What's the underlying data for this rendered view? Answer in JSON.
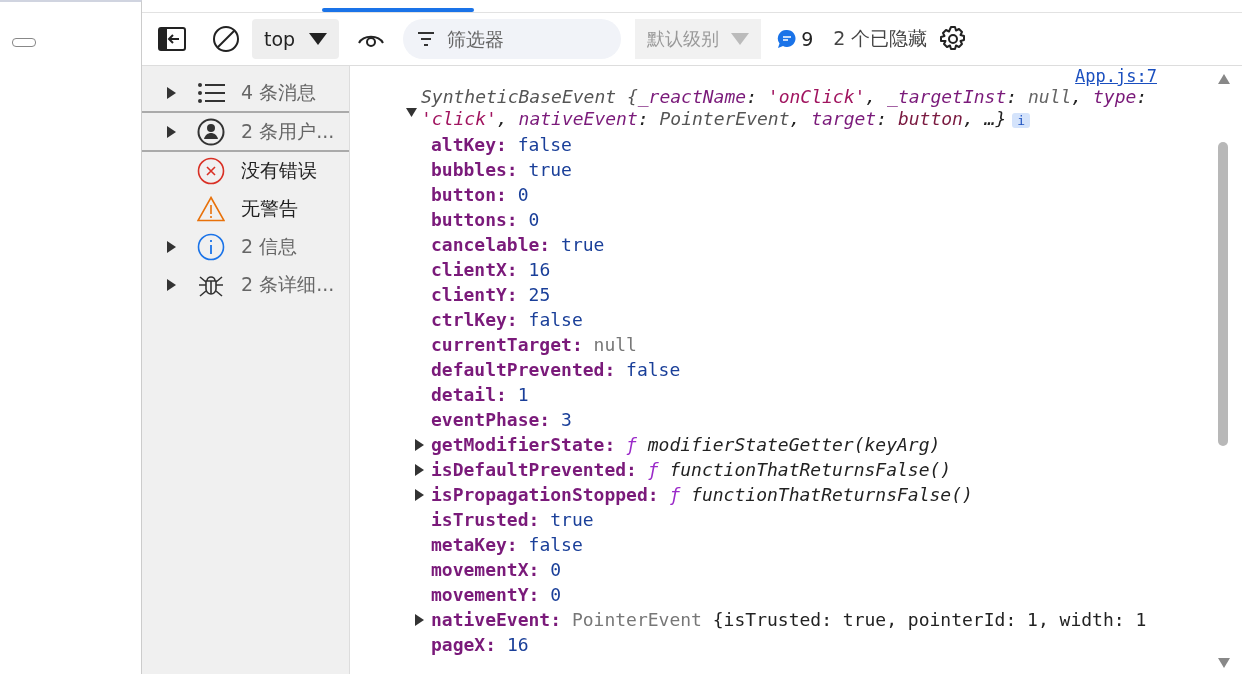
{
  "toolbar": {
    "context": "top",
    "filter": {
      "placeholder": "筛选器"
    },
    "level_menu": {
      "label": "默认级别",
      "disabled": true
    },
    "message_count": "9",
    "hidden_count": "2 个已隐藏"
  },
  "sidebar": {
    "items": [
      {
        "label": "4 条消息",
        "kind": "list",
        "expandable": true
      },
      {
        "label": "2 条用户...",
        "kind": "user",
        "expandable": true
      },
      {
        "label": "没有错误",
        "kind": "error",
        "expandable": false
      },
      {
        "label": "无警告",
        "kind": "warning",
        "expandable": false
      },
      {
        "label": "2 信息",
        "kind": "info",
        "expandable": true
      },
      {
        "label": "2 条详细...",
        "kind": "bug",
        "expandable": true
      }
    ]
  },
  "console": {
    "source_link": "App.js:7",
    "expanded": true,
    "summary": [
      {
        "text": "SyntheticBaseEvent {",
        "kind": "class"
      },
      {
        "text": "_reactName",
        "kind": "key"
      },
      {
        "text": ": ",
        "kind": "punct"
      },
      {
        "text": "'onClick'",
        "kind": "string"
      },
      {
        "text": ", ",
        "kind": "punct"
      },
      {
        "text": "_targetInst",
        "kind": "key"
      },
      {
        "text": ": ",
        "kind": "punct"
      },
      {
        "text": "null",
        "kind": "null"
      },
      {
        "text": ", ",
        "kind": "punct"
      },
      {
        "text": "type",
        "kind": "key"
      },
      {
        "text": ": ",
        "kind": "punct"
      },
      {
        "text": "'click'",
        "kind": "string"
      },
      {
        "text": ", ",
        "kind": "punct"
      },
      {
        "text": "nativeEvent",
        "kind": "key"
      },
      {
        "text": ": ",
        "kind": "punct"
      },
      {
        "text": "PointerEvent",
        "kind": "class"
      },
      {
        "text": ", ",
        "kind": "punct"
      },
      {
        "text": "target",
        "kind": "key"
      },
      {
        "text": ": ",
        "kind": "punct"
      },
      {
        "text": "button",
        "kind": "value"
      },
      {
        "text": ", …}",
        "kind": "punct"
      }
    ],
    "info_badge": "i",
    "properties": [
      {
        "name": "altKey:",
        "value": "false",
        "kind": "keyword",
        "expandable": false
      },
      {
        "name": "bubbles:",
        "value": "true",
        "kind": "keyword",
        "expandable": false
      },
      {
        "name": "button:",
        "value": "0",
        "kind": "number",
        "expandable": false
      },
      {
        "name": "buttons:",
        "value": "0",
        "kind": "number",
        "expandable": false
      },
      {
        "name": "cancelable:",
        "value": "true",
        "kind": "keyword",
        "expandable": false
      },
      {
        "name": "clientX:",
        "value": "16",
        "kind": "number",
        "expandable": false
      },
      {
        "name": "clientY:",
        "value": "25",
        "kind": "number",
        "expandable": false
      },
      {
        "name": "ctrlKey:",
        "value": "false",
        "kind": "keyword",
        "expandable": false
      },
      {
        "name": "currentTarget:",
        "value": "null",
        "kind": "null",
        "expandable": false
      },
      {
        "name": "defaultPrevented:",
        "value": "false",
        "kind": "keyword",
        "expandable": false
      },
      {
        "name": "detail:",
        "value": "1",
        "kind": "number",
        "expandable": false
      },
      {
        "name": "eventPhase:",
        "value": "3",
        "kind": "number",
        "expandable": false
      },
      {
        "name": "getModifierState:",
        "prefix": "ƒ",
        "value": "modifierStateGetter(keyArg)",
        "kind": "function",
        "expandable": true
      },
      {
        "name": "isDefaultPrevented:",
        "prefix": "ƒ",
        "value": "functionThatReturnsFalse()",
        "kind": "function",
        "expandable": true
      },
      {
        "name": "isPropagationStopped:",
        "prefix": "ƒ",
        "value": "functionThatReturnsFalse()",
        "kind": "function",
        "expandable": true
      },
      {
        "name": "isTrusted:",
        "value": "true",
        "kind": "keyword",
        "expandable": false
      },
      {
        "name": "metaKey:",
        "value": "false",
        "kind": "keyword",
        "expandable": false
      },
      {
        "name": "movementX:",
        "value": "0",
        "kind": "number",
        "expandable": false
      },
      {
        "name": "movementY:",
        "value": "0",
        "kind": "number",
        "expandable": false
      },
      {
        "name": "nativeEvent:",
        "prefix": "PointerEvent",
        "value": "{isTrusted: true, pointerId: 1, width: 1",
        "kind": "object",
        "expandable": true
      },
      {
        "name": "pageX:",
        "value": "16",
        "kind": "number",
        "expandable": false
      }
    ]
  }
}
